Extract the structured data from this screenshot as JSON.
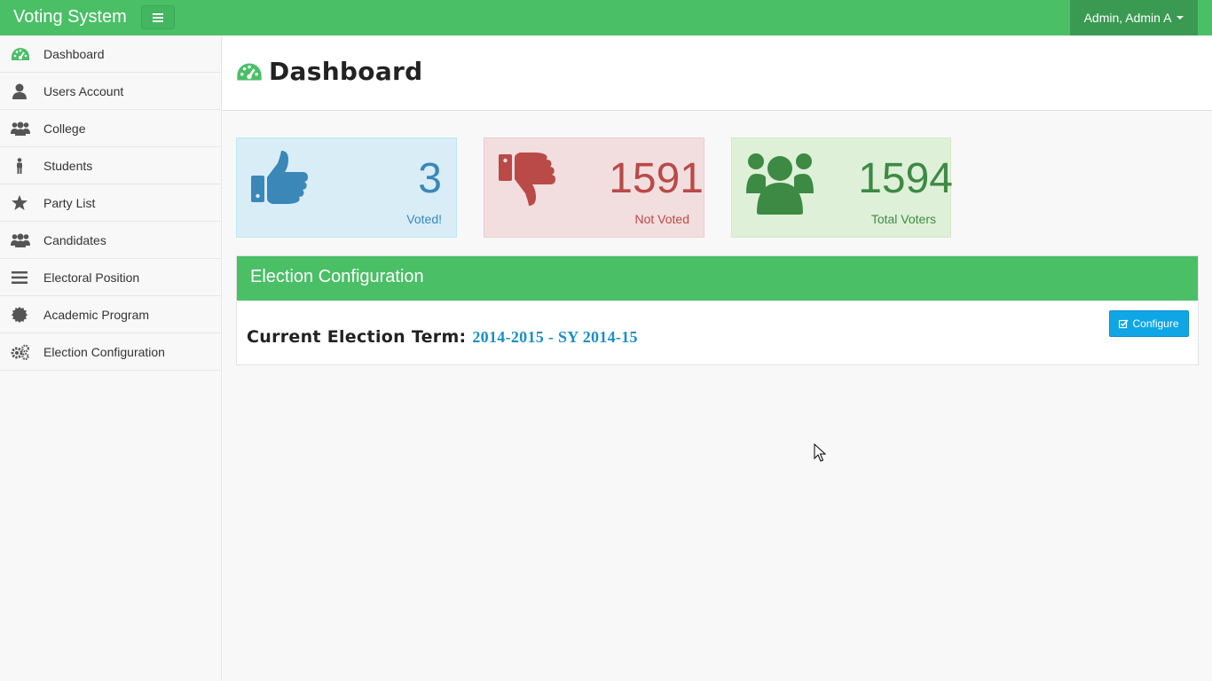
{
  "navbar": {
    "brand": "Voting System",
    "toggle_icon": "hamburger-icon",
    "user_menu": "Admin, Admin A"
  },
  "sidebar": {
    "items": [
      {
        "label": "Dashboard",
        "icon": "dashboard-icon",
        "color": "#4abf66"
      },
      {
        "label": "Users Account",
        "icon": "user-icon"
      },
      {
        "label": "College",
        "icon": "group-icon"
      },
      {
        "label": "Students",
        "icon": "male-icon"
      },
      {
        "label": "Party List",
        "icon": "star-icon"
      },
      {
        "label": "Candidates",
        "icon": "group-icon"
      },
      {
        "label": "Electoral Position",
        "icon": "list-icon"
      },
      {
        "label": "Academic Program",
        "icon": "certificate-icon"
      },
      {
        "label": "Election Configuration",
        "icon": "cogs-icon"
      }
    ]
  },
  "page": {
    "title": "Dashboard"
  },
  "stats": {
    "voted": {
      "value": "3",
      "label": "Voted!",
      "icon": "thumbs-up-icon",
      "color": "#3a87b8"
    },
    "not_voted": {
      "value": "1591",
      "label": "Not Voted",
      "icon": "thumbs-down-icon",
      "color": "#b94a48"
    },
    "total": {
      "value": "1594",
      "label": "Total Voters",
      "icon": "users-icon",
      "color": "#3c8a44"
    }
  },
  "election_panel": {
    "heading": "Election Configuration",
    "term_label": "Current Election Term:",
    "term_value": "2014-2015 - SY 2014-15",
    "configure_label": "Configure"
  },
  "colors": {
    "brand_green": "#4abf66",
    "user_menu_bg": "#3a9a52",
    "configure_blue": "#0fa6e6"
  }
}
